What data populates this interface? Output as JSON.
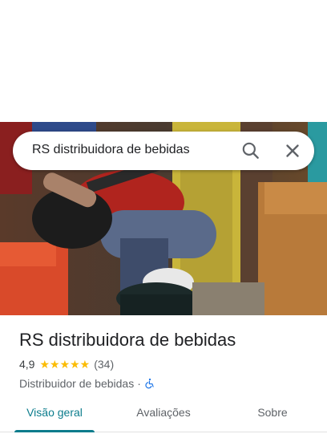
{
  "search": {
    "query": "RS distribuidora de bebidas"
  },
  "place": {
    "name": "RS distribuidora de bebidas",
    "rating": "4,9",
    "stars": "★★★★★",
    "review_count": "(34)",
    "category": "Distribuidor de bebidas",
    "separator": "·"
  },
  "tabs": [
    {
      "label": "Visão geral"
    },
    {
      "label": "Avaliações"
    },
    {
      "label": "Sobre"
    }
  ],
  "colors": {
    "accent": "#0b7c8c",
    "star": "#fbbc04",
    "wheelchair": "#1a73e8"
  },
  "icons": {
    "search": "search-icon",
    "close": "close-icon",
    "accessibility": "wheelchair-icon"
  }
}
